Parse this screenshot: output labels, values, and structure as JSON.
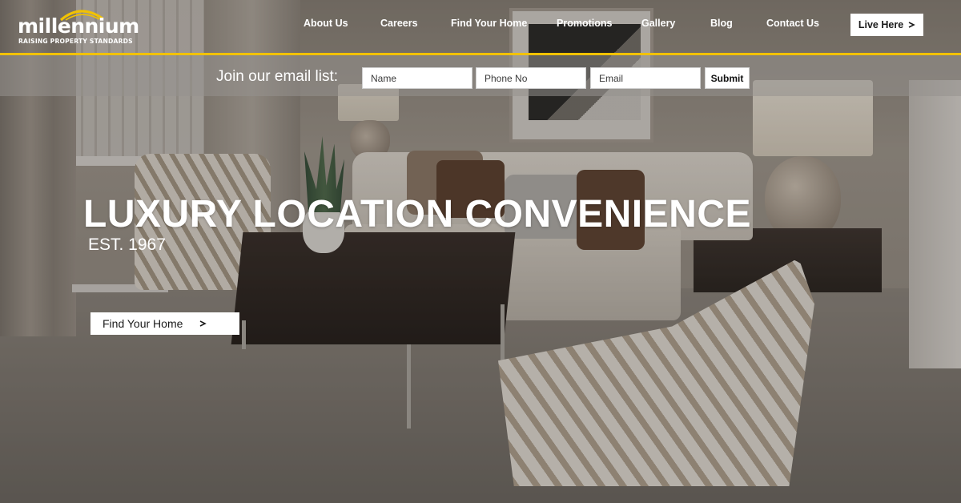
{
  "brand": {
    "name": "millennium",
    "tagline": "RAISING PROPERTY STANDARDS",
    "accent_color": "#f2c200"
  },
  "nav": {
    "items": [
      {
        "label": "About Us"
      },
      {
        "label": "Careers"
      },
      {
        "label": "Find Your Home"
      },
      {
        "label": "Promotions"
      },
      {
        "label": "Gallery"
      },
      {
        "label": "Blog"
      },
      {
        "label": "Contact Us"
      }
    ],
    "cta_label": "Live Here",
    "cta_icon": "chevron-right-icon"
  },
  "email_signup": {
    "label": "Join our email list:",
    "name_placeholder": "Name",
    "phone_placeholder": "Phone No",
    "email_placeholder": "Email",
    "submit_label": "Submit"
  },
  "hero": {
    "title": "LUXURY LOCATION CONVENIENCE",
    "established": "EST. 1967",
    "button_label": "Find Your Home",
    "button_icon": "chevron-right-icon"
  }
}
